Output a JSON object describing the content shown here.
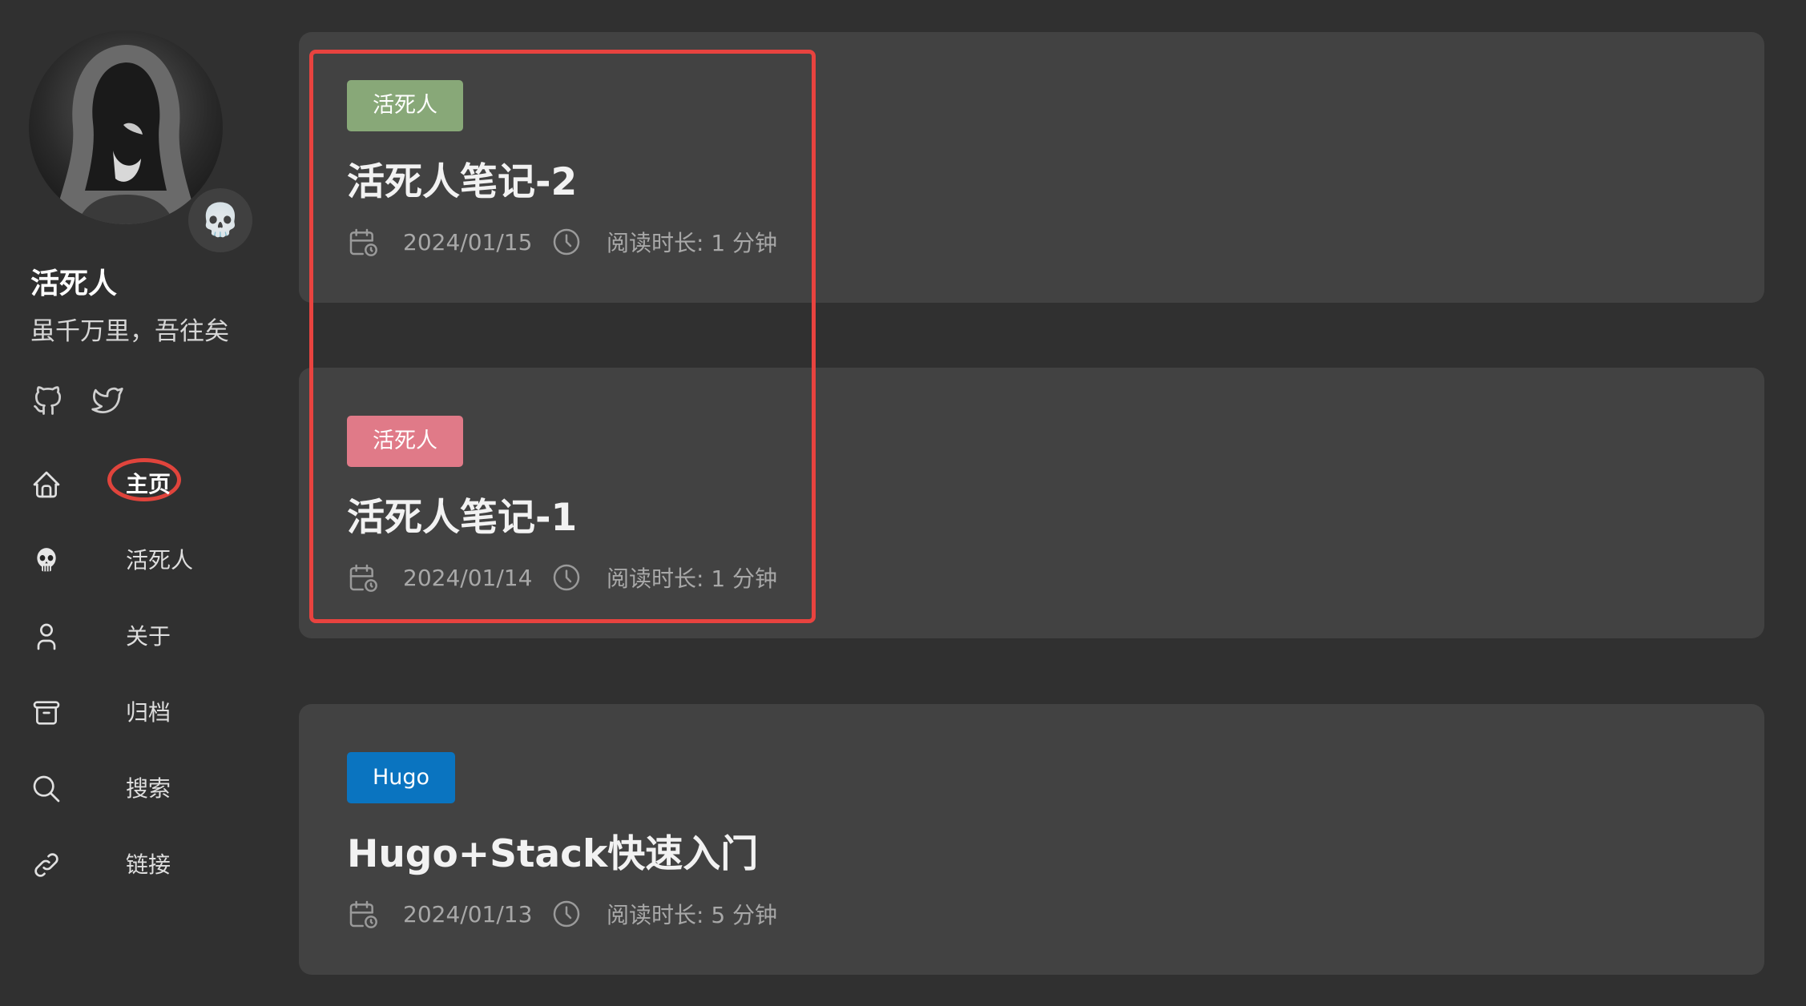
{
  "colors": {
    "background": "#303030",
    "card": "#424242",
    "annotation_red": "#e8433f"
  },
  "sidebar": {
    "avatar_emoji": "💀",
    "site_name": "活死人",
    "site_description": "虽千万里，吾往矣",
    "social": [
      {
        "icon": "github-icon"
      },
      {
        "icon": "twitter-icon"
      }
    ],
    "menu": [
      {
        "icon": "home-icon",
        "label": "主页",
        "active": true
      },
      {
        "icon": "skull-icon",
        "label": "活死人",
        "active": false
      },
      {
        "icon": "user-icon",
        "label": "关于",
        "active": false
      },
      {
        "icon": "archive-icon",
        "label": "归档",
        "active": false
      },
      {
        "icon": "search-icon",
        "label": "搜索",
        "active": false
      },
      {
        "icon": "link-icon",
        "label": "链接",
        "active": false
      }
    ]
  },
  "articles": [
    {
      "tag": "活死人",
      "tag_color": "#88a878",
      "title": "活死人笔记-2",
      "date": "2024/01/15",
      "reading_time": "阅读时长: 1 分钟"
    },
    {
      "tag": "活死人",
      "tag_color": "#e07a88",
      "title": "活死人笔记-1",
      "date": "2024/01/14",
      "reading_time": "阅读时长: 1 分钟"
    },
    {
      "tag": "Hugo",
      "tag_color": "#0a74c0",
      "title": "Hugo+Stack快速入门",
      "date": "2024/01/13",
      "reading_time": "阅读时长: 5 分钟"
    }
  ]
}
